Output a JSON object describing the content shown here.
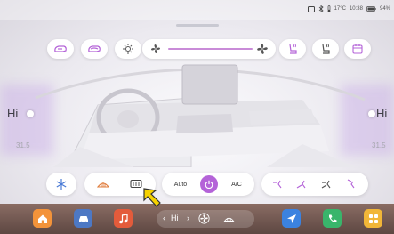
{
  "status": {
    "temperature": "17°C",
    "time": "10:38",
    "battery": "94%"
  },
  "climate": {
    "left_zone_label": "Hi",
    "right_zone_label": "Hi",
    "left_temp": "31.5",
    "right_temp": "31.5",
    "auto_label": "Auto",
    "ac_label": "A/C"
  },
  "dock": {
    "center_left_label": "Hi"
  },
  "colors": {
    "accent": "#b463d8",
    "warm": "#e07b3a",
    "cool": "#4b7bd6",
    "dock_home": "#f3933a",
    "dock_car": "#4d78c4",
    "dock_music": "#e35b3b",
    "dock_nav": "#3b82e0",
    "dock_phone": "#39b56b",
    "dock_apps": "#f1b638"
  }
}
